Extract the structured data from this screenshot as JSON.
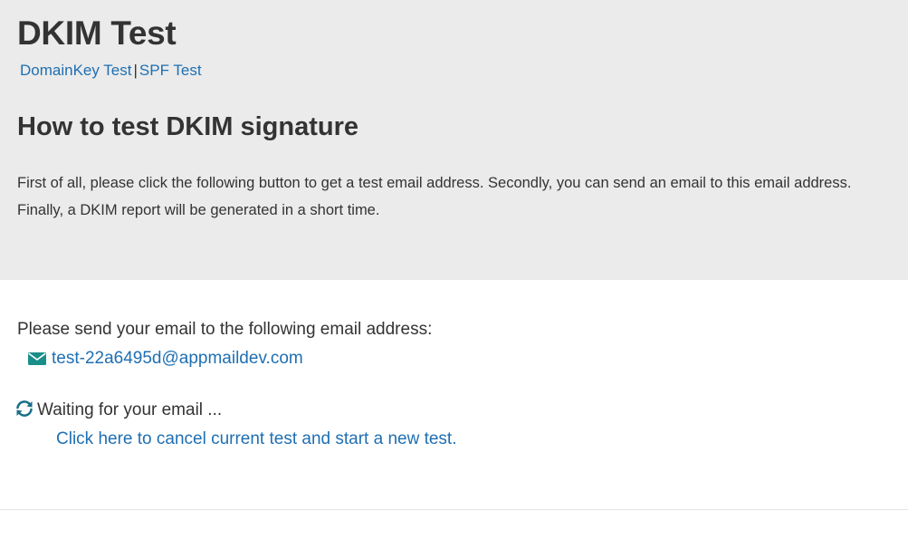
{
  "header": {
    "title": "DKIM Test",
    "nav": {
      "domainkey_label": "DomainKey Test",
      "separator": "|",
      "spf_label": "SPF Test"
    },
    "subtitle": "How to test DKIM signature",
    "intro": "First of all, please click the following button to get a test email address. Secondly, you can send an email to this email address. Finally, a DKIM report will be generated in a short time."
  },
  "main": {
    "prompt": "Please send your email to the following email address:",
    "email_icon": "envelope-icon",
    "email_address": "test-22a6495d@appmaildev.com",
    "waiting_icon": "refresh-icon",
    "waiting_text": "Waiting for your email ...",
    "cancel_link": "Click here to cancel current test and start a new test."
  },
  "colors": {
    "hero_background": "#ebebeb",
    "link": "#1f6fb2",
    "icon_teal": "#1a8f8a",
    "text": "#333333"
  }
}
